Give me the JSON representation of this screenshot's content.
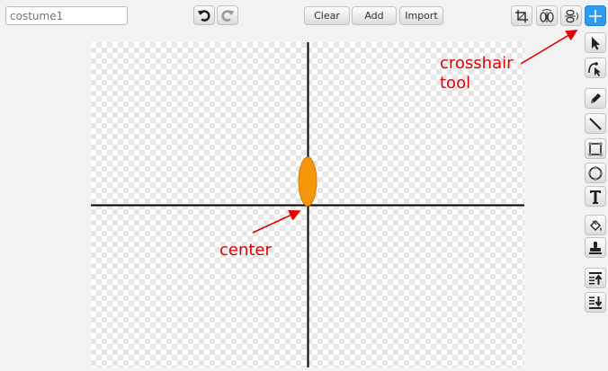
{
  "costume_name": {
    "value": "",
    "placeholder": "costume1"
  },
  "toolbar": {
    "undo_icon": "undo-icon",
    "redo_icon": "redo-icon",
    "clear_label": "Clear",
    "add_label": "Add",
    "import_label": "Import",
    "top_tools": [
      "crop-icon",
      "flip-horizontal-icon",
      "flip-vertical-icon",
      "crosshair-icon"
    ]
  },
  "side_tools": [
    "select-arrow-icon",
    "reshape-icon",
    "pencil-icon",
    "line-icon",
    "rectangle-icon",
    "ellipse-icon",
    "text-icon",
    "paint-bucket-icon",
    "stamp-icon",
    "bring-forward-icon",
    "send-backward-icon"
  ],
  "annotations": {
    "crosshair_line1": "crosshair",
    "crosshair_line2": "tool",
    "center": "center"
  },
  "colors": {
    "accent": "#2d9bf0",
    "annotation": "#e00000",
    "shape_fill": "#f5960a",
    "shape_stroke": "#d97d00"
  }
}
